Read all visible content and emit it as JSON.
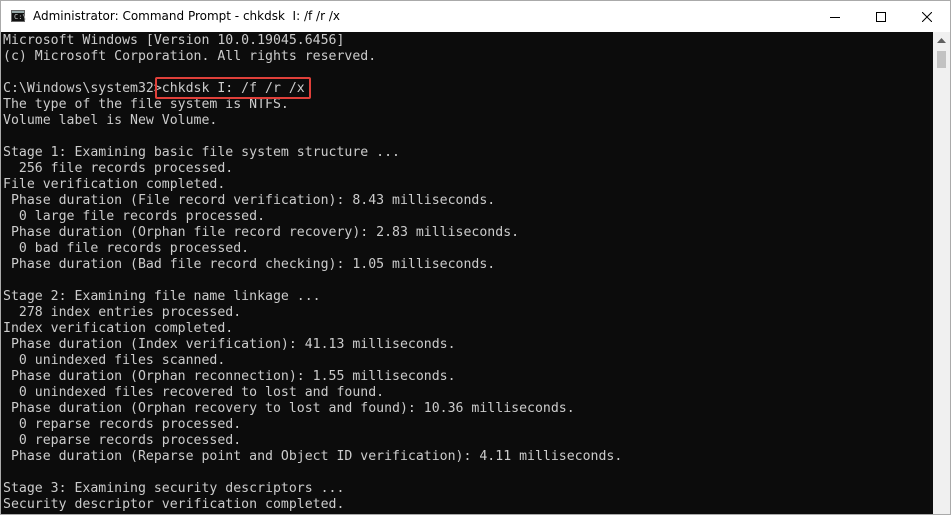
{
  "window": {
    "title": "Administrator: Command Prompt - chkdsk  I: /f /r /x",
    "icon": "command-prompt-icon",
    "icon_text": "C:\\"
  },
  "console": {
    "lines": [
      "Microsoft Windows [Version 10.0.19045.6456]",
      "(c) Microsoft Corporation. All rights reserved.",
      "",
      "C:\\Windows\\system32>chkdsk I: /f /r /x",
      "The type of the file system is NTFS.",
      "Volume label is New Volume.",
      "",
      "Stage 1: Examining basic file system structure ...",
      "  256 file records processed.",
      "File verification completed.",
      " Phase duration (File record verification): 8.43 milliseconds.",
      "  0 large file records processed.",
      " Phase duration (Orphan file record recovery): 2.83 milliseconds.",
      "  0 bad file records processed.",
      " Phase duration (Bad file record checking): 1.05 milliseconds.",
      "",
      "Stage 2: Examining file name linkage ...",
      "  278 index entries processed.",
      "Index verification completed.",
      " Phase duration (Index verification): 41.13 milliseconds.",
      "  0 unindexed files scanned.",
      " Phase duration (Orphan reconnection): 1.55 milliseconds.",
      "  0 unindexed files recovered to lost and found.",
      " Phase duration (Orphan recovery to lost and found): 10.36 milliseconds.",
      "  0 reparse records processed.",
      "  0 reparse records processed.",
      " Phase duration (Reparse point and Object ID verification): 4.11 milliseconds.",
      "",
      "Stage 3: Examining security descriptors ...",
      "Security descriptor verification completed."
    ]
  },
  "colors": {
    "console_bg": "#0c0c0c",
    "console_fg": "#cccccc",
    "highlight": "#e0403a"
  }
}
